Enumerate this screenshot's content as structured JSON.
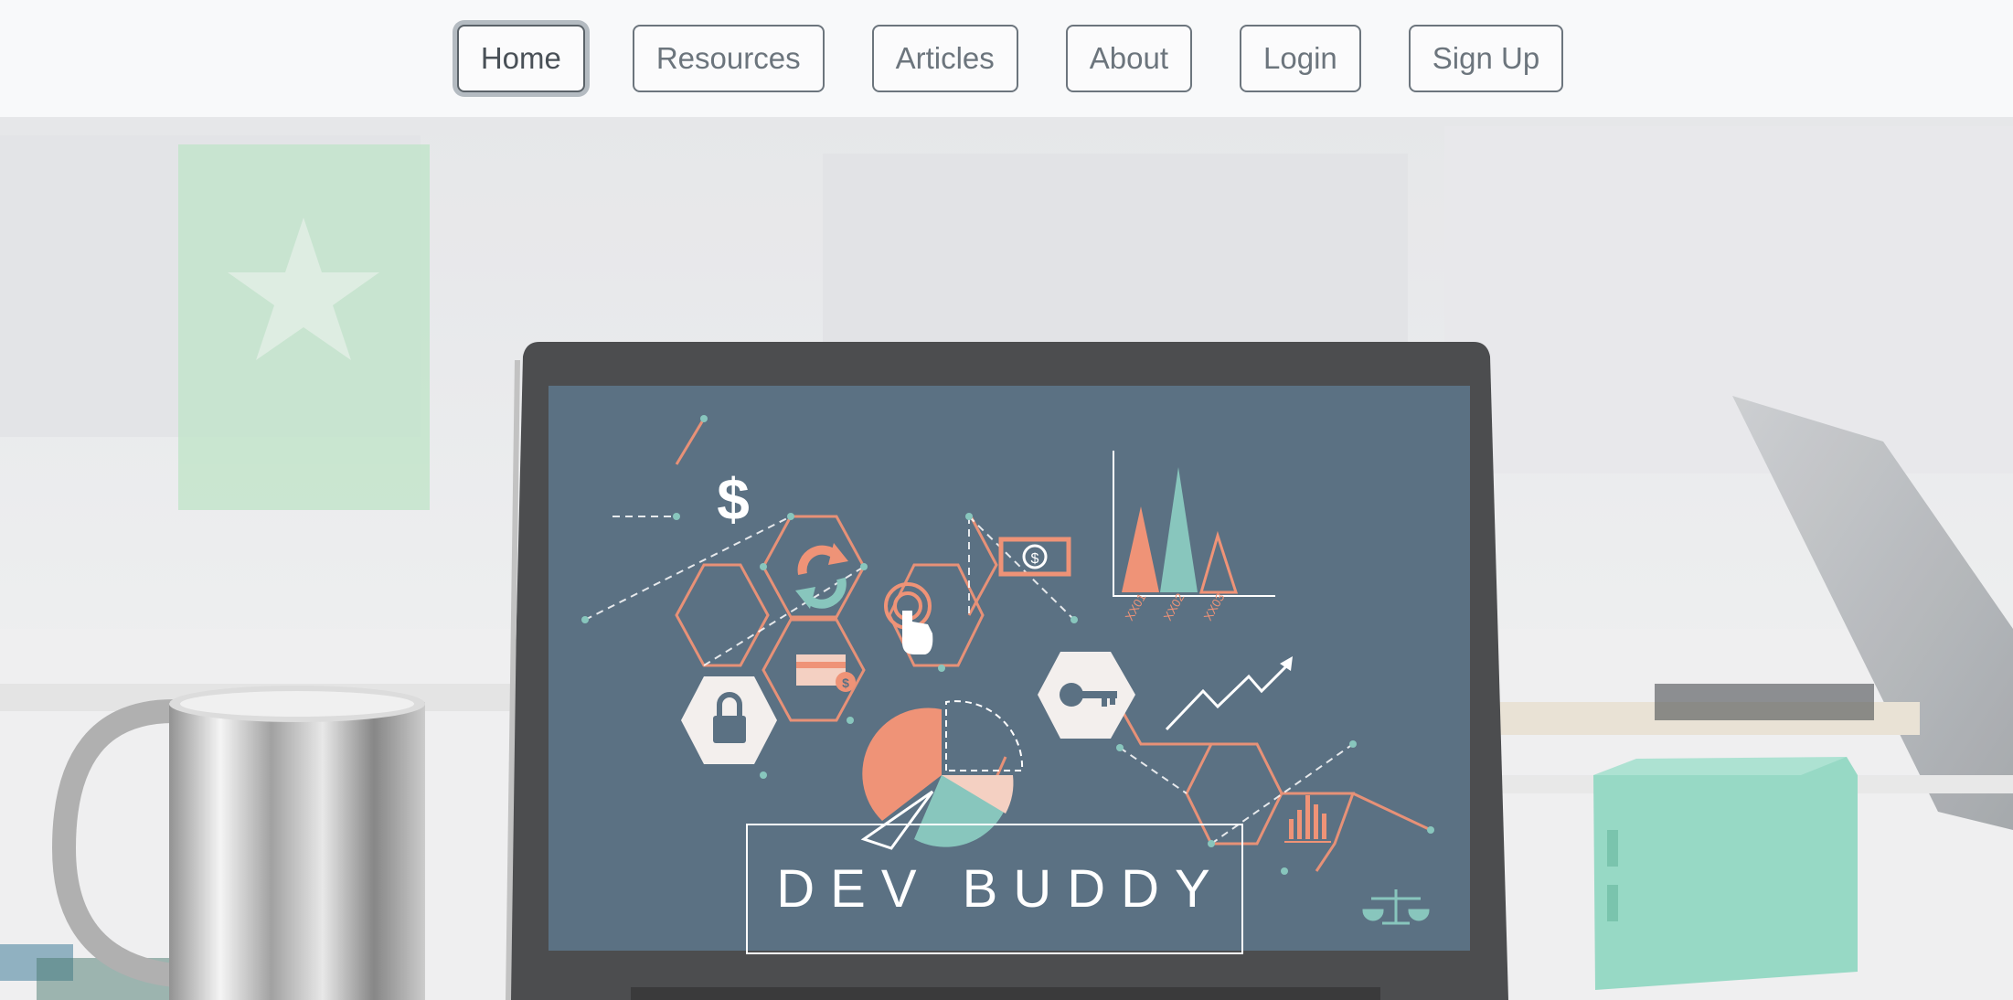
{
  "nav": {
    "items": [
      {
        "label": "Home",
        "active": true
      },
      {
        "label": "Resources"
      },
      {
        "label": "Articles"
      },
      {
        "label": "About"
      },
      {
        "label": "Login"
      },
      {
        "label": "Sign Up"
      }
    ]
  },
  "hero": {
    "title": "DEV BUDDY",
    "screen_chart_labels": [
      "XX01",
      "XX02",
      "XX03"
    ],
    "icons": [
      "dollar-icon",
      "refresh-icon",
      "touch-icon",
      "banknote-icon",
      "credit-card-icon",
      "lock-icon",
      "key-icon",
      "trend-arrow-icon",
      "pie-chart-icon",
      "bar-chart-icon",
      "scales-icon"
    ]
  },
  "colors": {
    "navbar_bg": "#f8f9fa",
    "button_border": "#6c757d",
    "screen_bg": "#4e6579",
    "accent_orange": "#ee8a6c",
    "accent_teal": "#7ec2b8",
    "speaker_teal": "#8fd6c1"
  }
}
